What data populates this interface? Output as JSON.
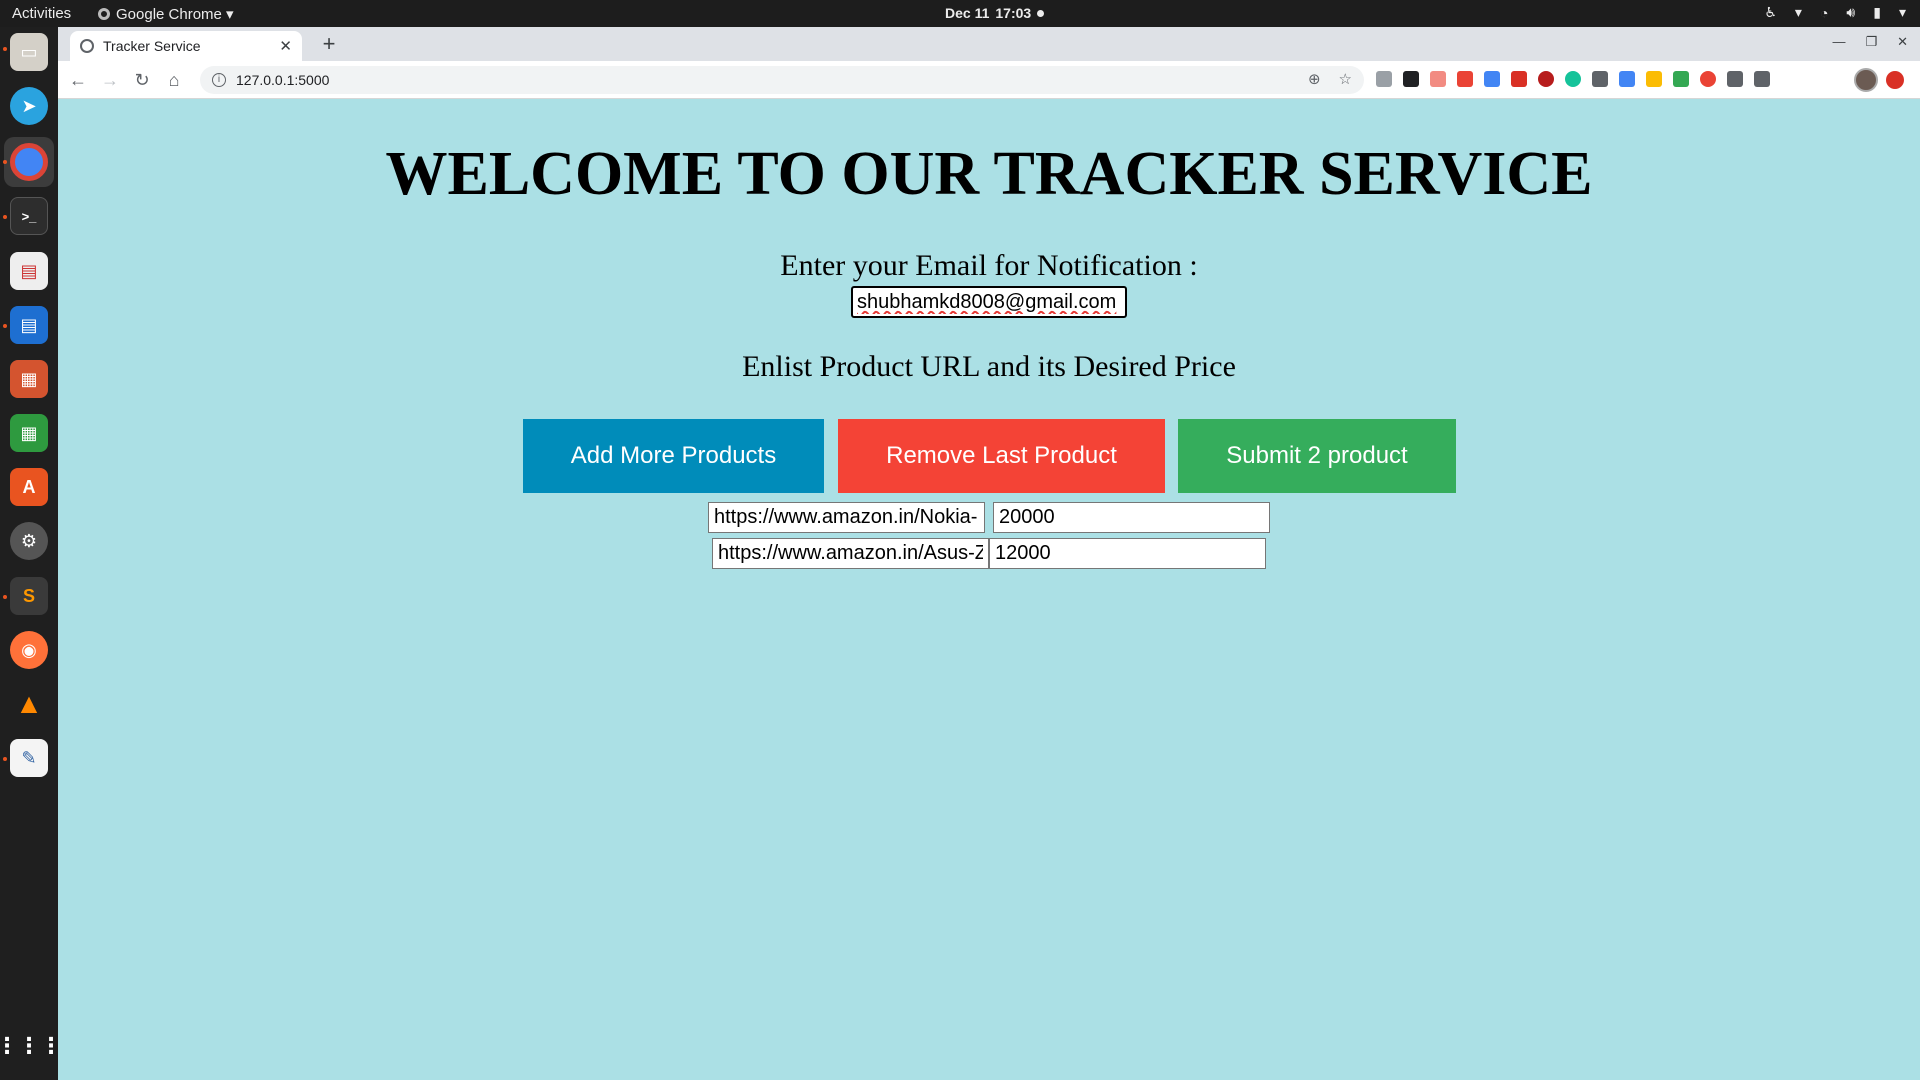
{
  "system": {
    "activities": "Activities",
    "app_name": "Google Chrome ▾",
    "date": "Dec 11",
    "time": "17:03"
  },
  "browser": {
    "tab_title": "Tracker Service",
    "url": "127.0.0.1:5000"
  },
  "page": {
    "heading": "WELCOME TO OUR TRACKER SERVICE",
    "email_label": "Enter your Email for Notification :",
    "email_value": "shubhamkd8008@gmail.com",
    "enlist_label": "Enlist Product URL and its Desired Price",
    "buttons": {
      "add": "Add More Products",
      "remove": "Remove Last Product",
      "submit": "Submit 2 product"
    },
    "products": [
      {
        "url": "https://www.amazon.in/Nokia-",
        "price": "20000"
      },
      {
        "url": "https://www.amazon.in/Asus-Z",
        "price": "12000"
      }
    ]
  },
  "colors": {
    "page_bg": "#abe0e5",
    "add_button": "#008cba",
    "remove_button": "#f44336",
    "submit_button": "#35ad5c"
  }
}
